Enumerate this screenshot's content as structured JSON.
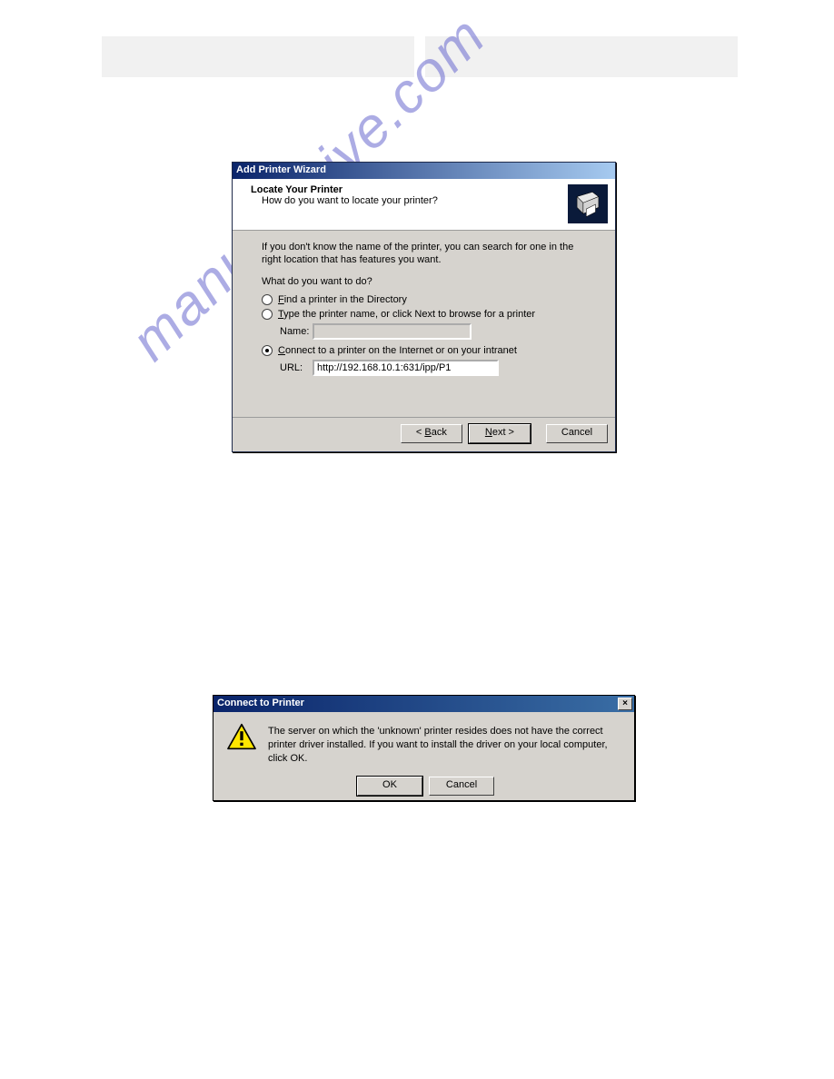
{
  "watermark": "manualshive.com",
  "wizard": {
    "title": "Add Printer Wizard",
    "header_title": "Locate Your Printer",
    "header_subtitle": "How do you want to locate your printer?",
    "intro": "If you don't know the name of the printer, you can search for one in the right location that has features you want.",
    "prompt": "What do you want to do?",
    "opt1_pre": "F",
    "opt1_accel": "",
    "opt1_rest": "ind a printer in the Directory",
    "opt2_pre": "T",
    "opt2_rest": "ype the printer name, or click Next to browse for a printer",
    "name_label": "Name:",
    "name_value": "",
    "opt3_pre": "C",
    "opt3_rest": "onnect to a printer on the Internet or on your intranet",
    "url_label": "URL:",
    "url_value": "http://192.168.10.1:631/ipp/P1",
    "btn_back_pre": "< ",
    "btn_back_accel": "B",
    "btn_back_rest": "ack",
    "btn_next_accel": "N",
    "btn_next_rest": "ext >",
    "btn_cancel": "Cancel"
  },
  "msgbox": {
    "title": "Connect to Printer",
    "close": "×",
    "text": "The server on which the 'unknown' printer resides does not have the correct printer driver installed. If you want to install the driver on your local computer, click OK.",
    "btn_ok": "OK",
    "btn_cancel": "Cancel"
  }
}
